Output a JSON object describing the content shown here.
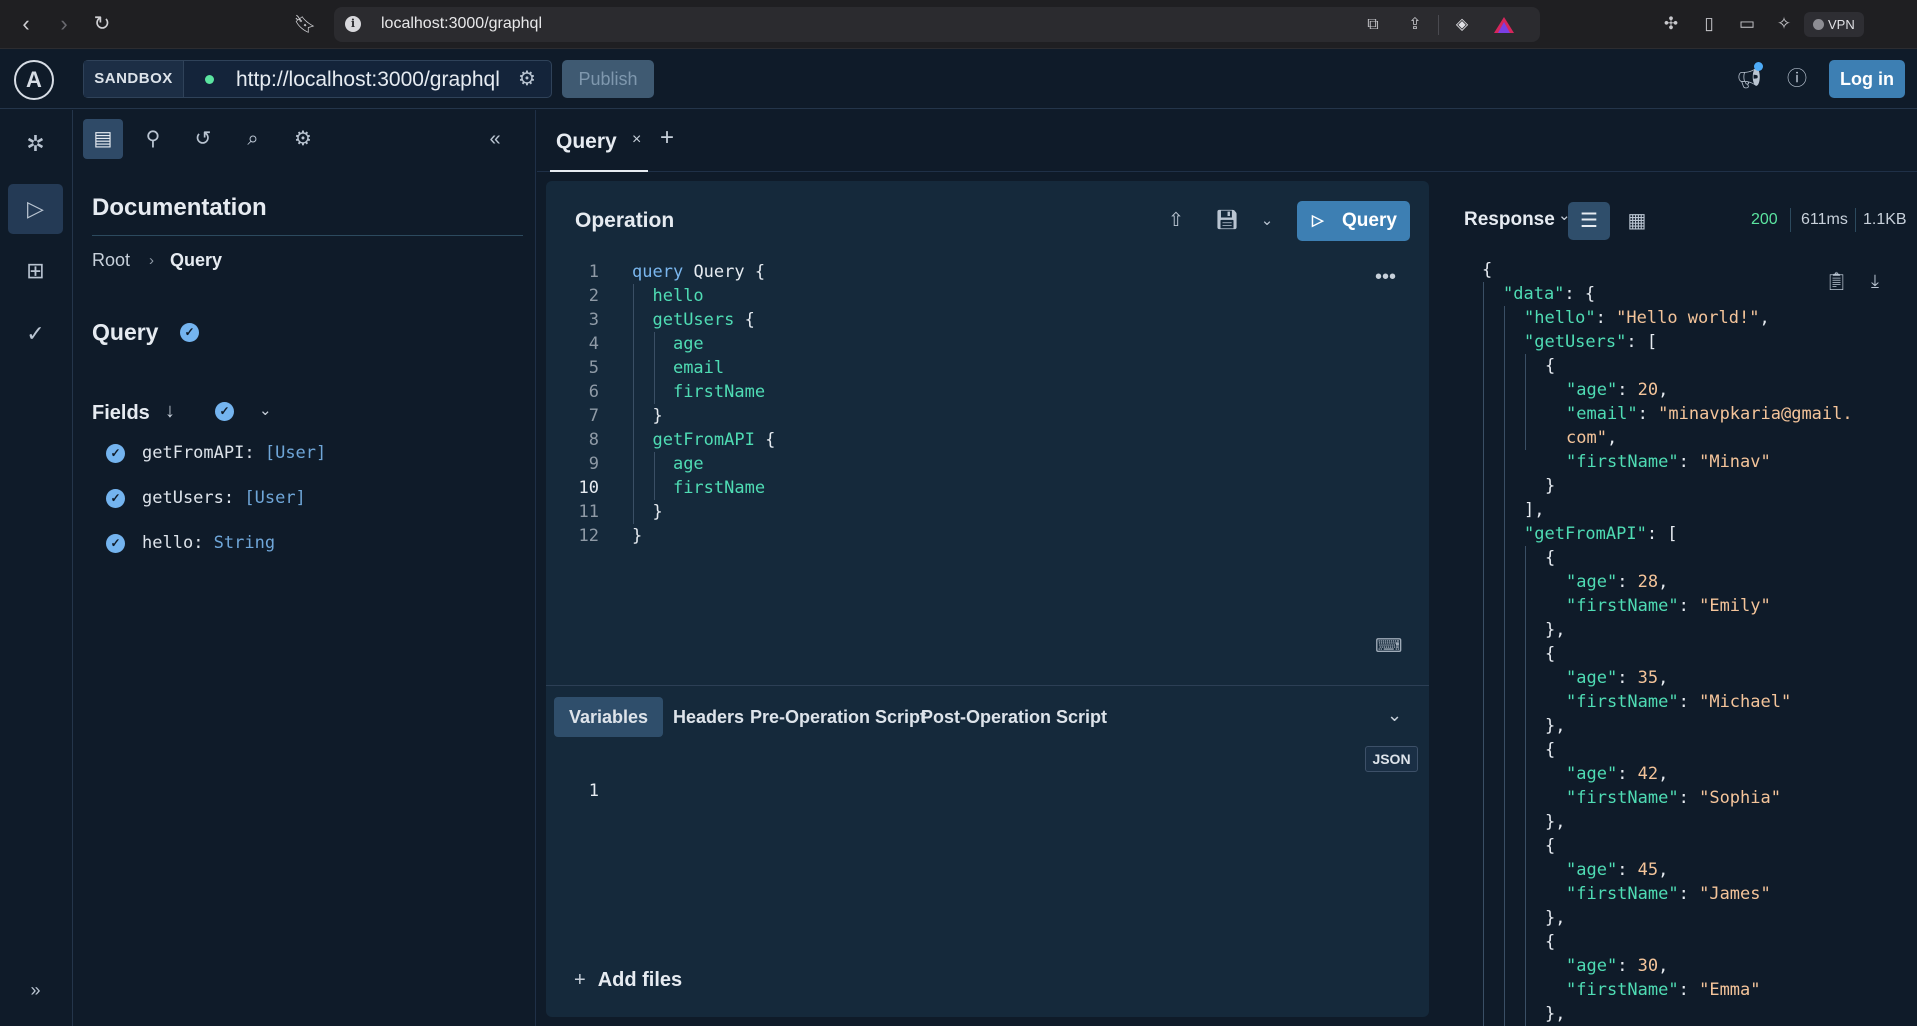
{
  "browser": {
    "url": "localhost:3000/graphql",
    "vpn_label": "VPN"
  },
  "topbar": {
    "sandbox_label": "SANDBOX",
    "endpoint_url": "http://localhost:3000/graphql",
    "publish_label": "Publish",
    "login_label": "Log in"
  },
  "docs": {
    "title": "Documentation",
    "breadcrumb": [
      "Root",
      "Query"
    ],
    "type_title": "Query",
    "fields_label": "Fields",
    "fields": [
      {
        "name": "getFromAPI",
        "type": "[User]"
      },
      {
        "name": "getUsers",
        "type": "[User]"
      },
      {
        "name": "hello",
        "type": "String"
      }
    ]
  },
  "tabs": [
    {
      "label": "Query"
    }
  ],
  "operation": {
    "title": "Operation",
    "run_label": "Query",
    "code": [
      "query Query {",
      "  hello",
      "  getUsers {",
      "    age",
      "    email",
      "    firstName",
      "  }",
      "  getFromAPI {",
      "    age",
      "    firstName",
      "  }",
      "}"
    ],
    "line_numbers": [
      "1",
      "2",
      "3",
      "4",
      "5",
      "6",
      "7",
      "8",
      "9",
      "10",
      "11",
      "12"
    ],
    "current_line": 10
  },
  "variables": {
    "tabs": [
      "Variables",
      "Headers",
      "Pre-Operation Script",
      "Post-Operation Script"
    ],
    "active_tab": "Variables",
    "format_badge": "JSON",
    "line_numbers": [
      "1"
    ],
    "add_files_label": "Add files"
  },
  "response": {
    "label": "Response",
    "status": "200",
    "time": "611ms",
    "size": "1.1KB",
    "body": {
      "hello": "Hello world!",
      "getUsers": [
        {
          "age": 20,
          "email_line1": "minavpkaria@gmail.",
          "email_line2": "com",
          "firstName": "Minav"
        }
      ],
      "getFromAPI": [
        {
          "age": 28,
          "firstName": "Emily"
        },
        {
          "age": 35,
          "firstName": "Michael"
        },
        {
          "age": 42,
          "firstName": "Sophia"
        },
        {
          "age": 45,
          "firstName": "James"
        },
        {
          "age": 30,
          "firstName": "Emma"
        }
      ]
    }
  },
  "colors": {
    "background": "#0f1b29",
    "panel": "#15293b",
    "accent": "#3d7fb3",
    "json_key": "#4fdcb4",
    "json_value": "#f4c49a",
    "keyword": "#7ab6ee",
    "status_ok": "#5be4a0"
  }
}
